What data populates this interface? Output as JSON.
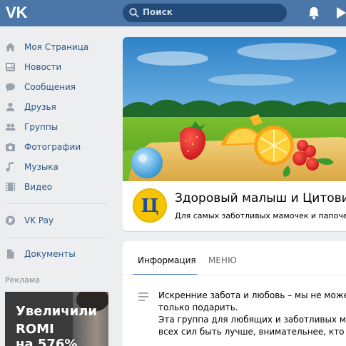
{
  "header": {
    "logo": "VK",
    "search_placeholder": "Поиск",
    "icons": [
      "vk-logo-icon",
      "search-icon",
      "bell-icon",
      "play-icon"
    ]
  },
  "sidebar": {
    "items": [
      {
        "label": "Моя Страница",
        "icon": "home-icon"
      },
      {
        "label": "Новости",
        "icon": "news-icon"
      },
      {
        "label": "Сообщения",
        "icon": "messages-icon"
      },
      {
        "label": "Друзья",
        "icon": "friends-icon"
      },
      {
        "label": "Группы",
        "icon": "groups-icon"
      },
      {
        "label": "Фотографии",
        "icon": "photos-icon"
      },
      {
        "label": "Музыка",
        "icon": "music-icon"
      },
      {
        "label": "Видео",
        "icon": "video-icon"
      }
    ],
    "vkpay": {
      "label": "VK Pay",
      "icon": "vkpay-icon"
    },
    "documents": {
      "label": "Документы",
      "icon": "documents-icon"
    },
    "ad_label": "Реклама",
    "ad": {
      "line1": "Увеличили",
      "line2": "ROMI",
      "line3": "на 576%"
    }
  },
  "group": {
    "avatar_letter": "Ц",
    "name": "Здоровый малыш и Цитовит",
    "status": "Для самых заботливых мамочек и папочек"
  },
  "tabs": {
    "info": "Информация",
    "menu": "МЕНЮ"
  },
  "description": {
    "lines": [
      "Искренние забота и любовь – мы не можем",
      "только подарить.",
      "Эта группа для любящих и заботливых мам",
      "всех сил быть лучше, внимательнее, кто да"
    ]
  },
  "colors": {
    "header": "#4a76a8",
    "link": "#2a5885",
    "accent": "#5181b8",
    "background": "#edeef0"
  }
}
